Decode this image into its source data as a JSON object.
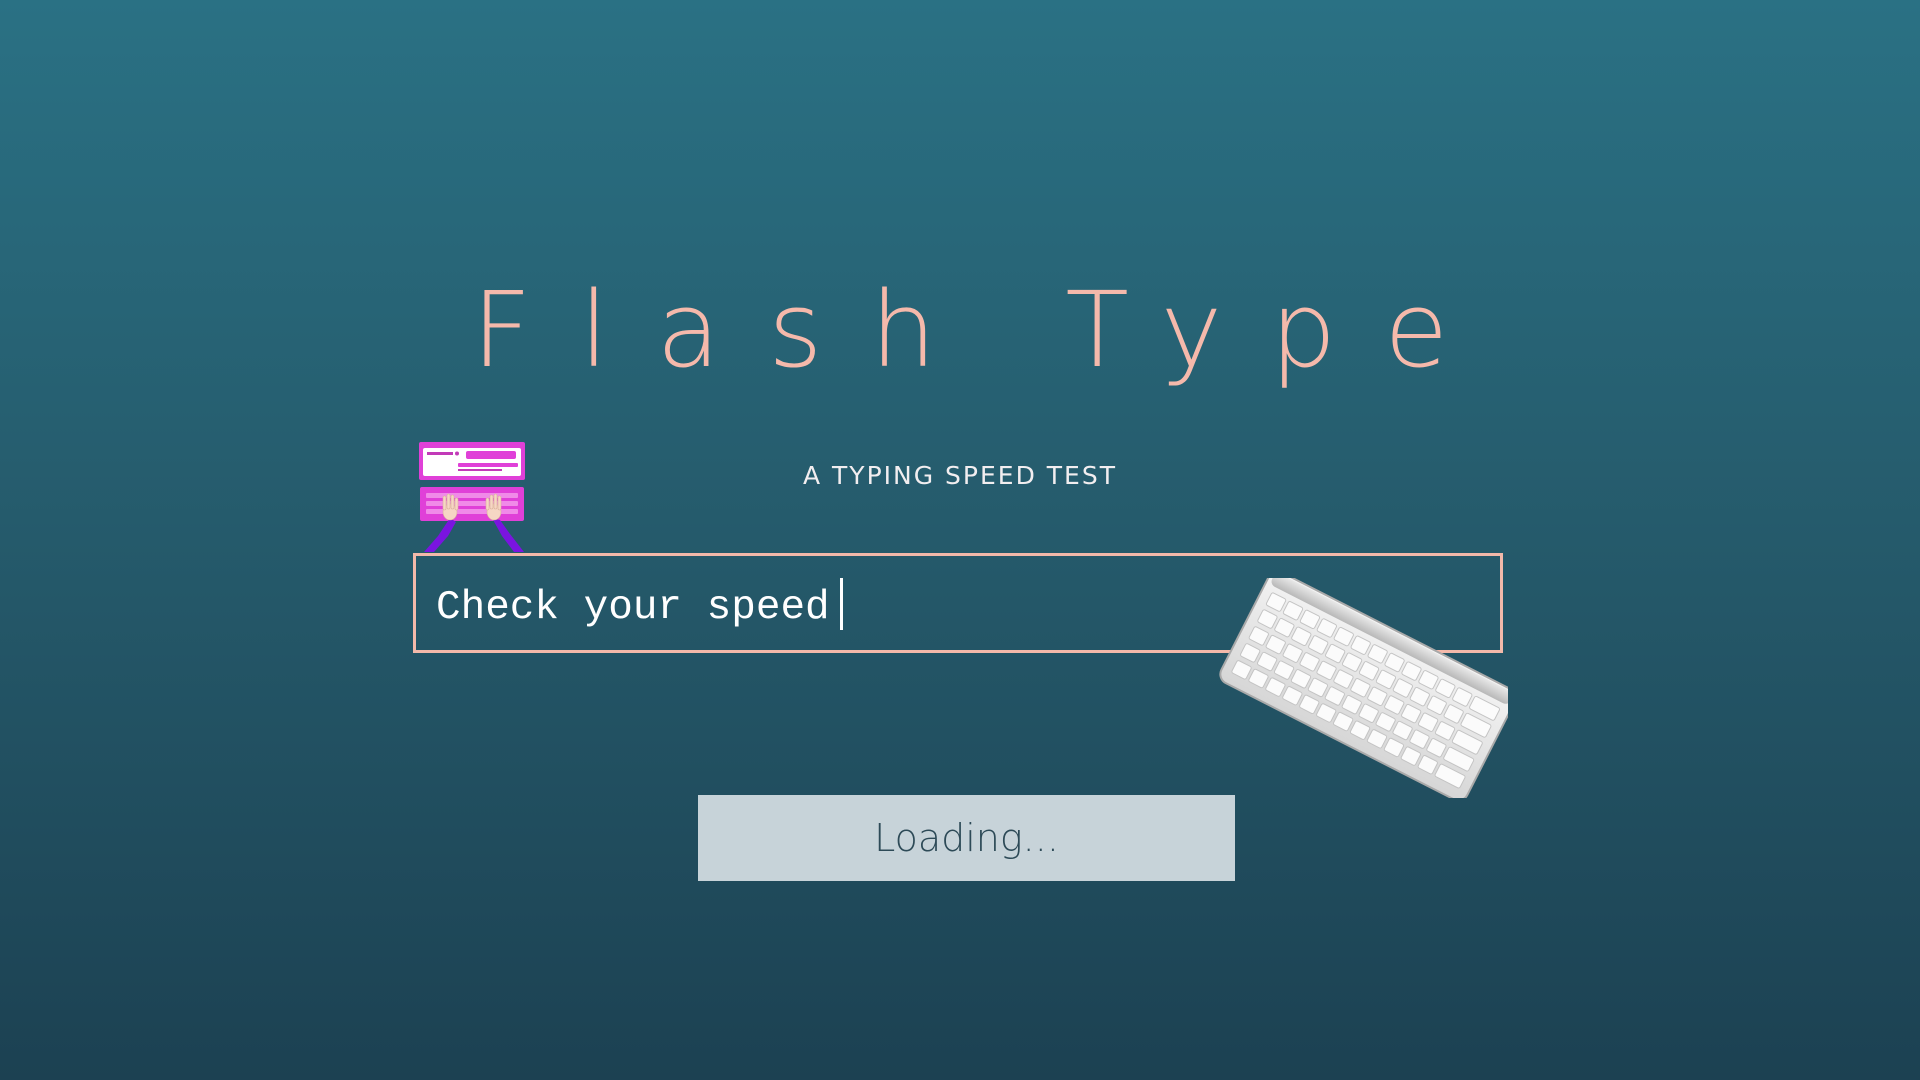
{
  "header": {
    "title": "Flash Type",
    "subtitle": "A typing speed test"
  },
  "typing_area": {
    "text": "Check your speed"
  },
  "action": {
    "button_label": "Loading..."
  },
  "colors": {
    "background_top": "#2a7184",
    "background_bottom": "#1c4152",
    "title": "#f5b9ab",
    "box_border": "#f3b9aa",
    "button_bg": "#c7d3d9",
    "button_text": "#2d4a57",
    "illustration_accent": "#e040d8"
  },
  "icons": {
    "left_illustration": "laptop-typing-hands-icon",
    "right_illustration": "keyboard-icon"
  }
}
